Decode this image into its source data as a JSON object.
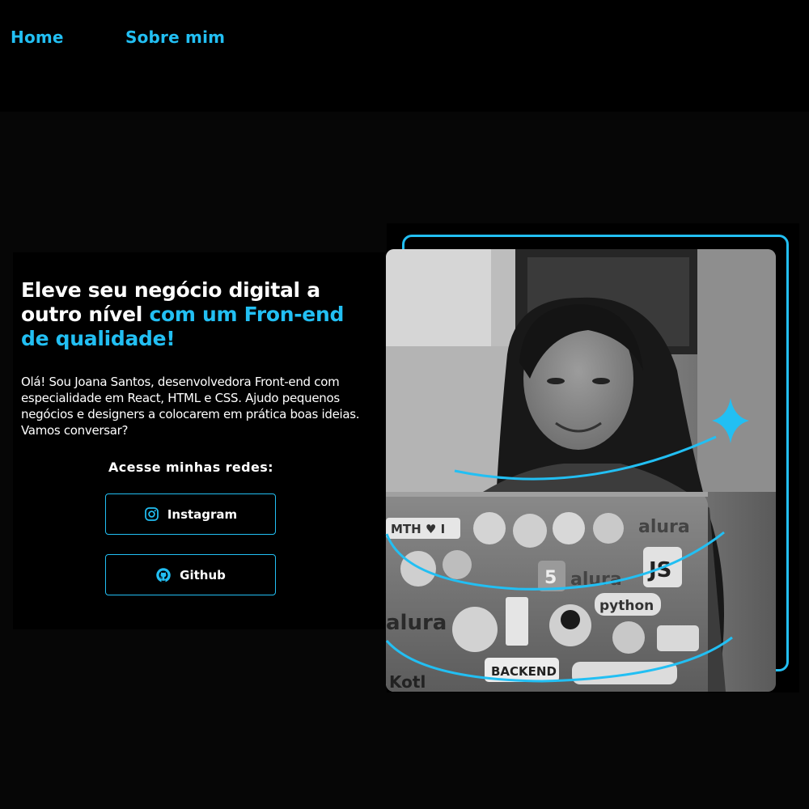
{
  "nav": {
    "home": "Home",
    "about": "Sobre mim"
  },
  "hero": {
    "headline_white": "Eleve seu negócio digital a outro nível",
    "headline_accent": "com um Fron-end de qualidade!",
    "intro": "Olá! Sou Joana Santos, desenvolvedora Front-end com especialidade em React, HTML e CSS. Ajudo pequenos negócios e designers a colocarem em prática boas ideias. Vamos conversar?",
    "social_title": "Acesse minhas redes:",
    "buttons": {
      "instagram": "Instagram",
      "github": "Github"
    }
  },
  "photo": {
    "stickers": [
      "MTH ♥ I",
      "alura",
      "JS",
      "alura",
      "python",
      "alura",
      "BACKEND",
      "Kotl",
      "5"
    ]
  },
  "icons": {
    "instagram": "instagram-icon",
    "github": "github-icon",
    "sparkle": "sparkle-icon"
  },
  "colors": {
    "accent": "#22bff3",
    "background": "#060606",
    "text": "#ffffff"
  }
}
